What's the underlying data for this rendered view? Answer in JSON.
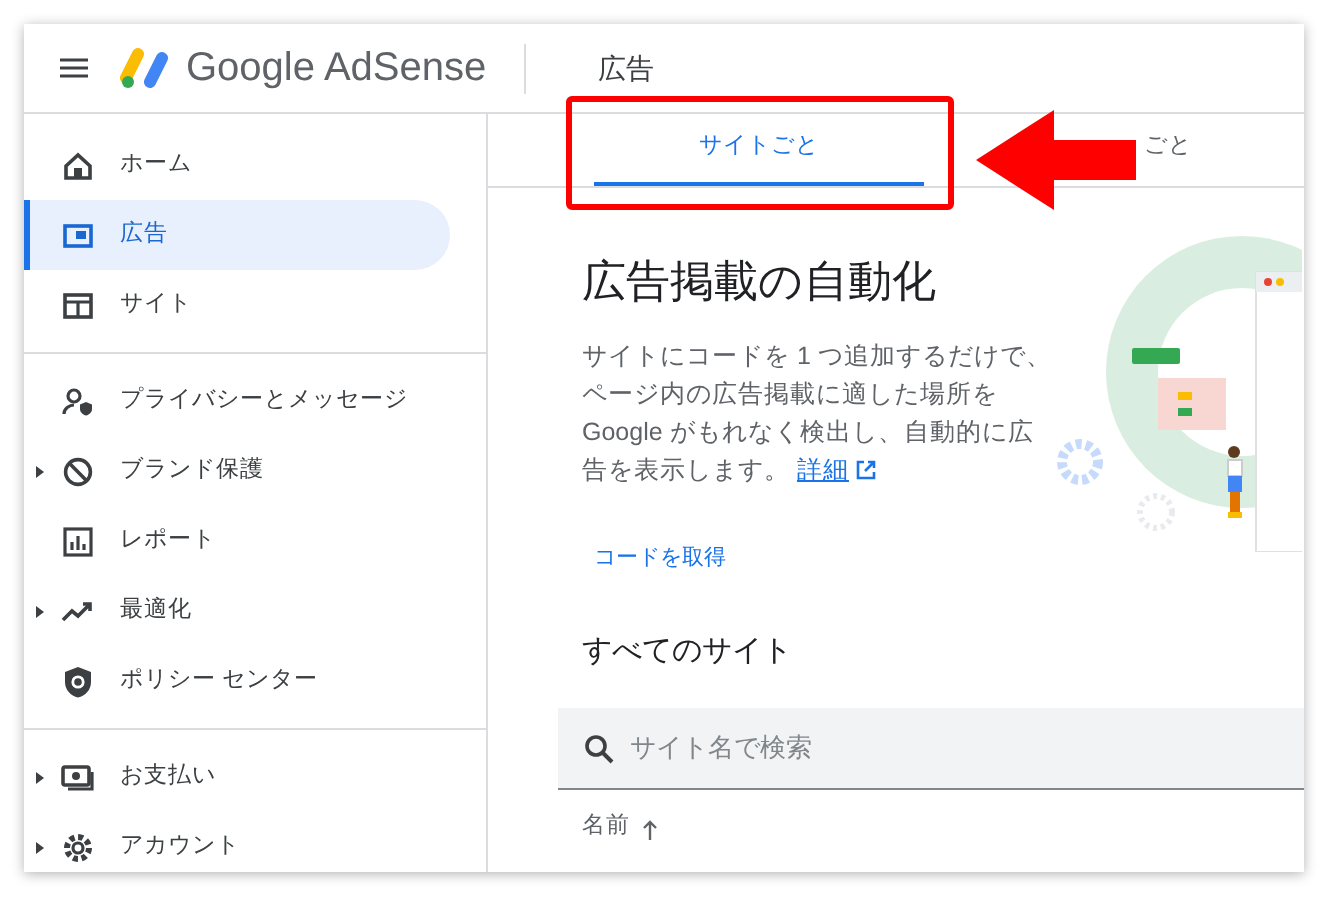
{
  "header": {
    "app_name": "Google AdSense",
    "page_title": "広告"
  },
  "sidebar": {
    "sections": [
      [
        {
          "label": "ホーム",
          "expandable": false,
          "selected": false
        },
        {
          "label": "広告",
          "expandable": false,
          "selected": true
        },
        {
          "label": "サイト",
          "expandable": false,
          "selected": false
        }
      ],
      [
        {
          "label": "プライバシーとメッセージ",
          "expandable": false,
          "selected": false
        },
        {
          "label": "ブランド保護",
          "expandable": true,
          "selected": false
        },
        {
          "label": "レポート",
          "expandable": false,
          "selected": false
        },
        {
          "label": "最適化",
          "expandable": true,
          "selected": false
        },
        {
          "label": "ポリシー センター",
          "expandable": false,
          "selected": false
        }
      ],
      [
        {
          "label": "お支払い",
          "expandable": true,
          "selected": false
        },
        {
          "label": "アカウント",
          "expandable": true,
          "selected": false
        }
      ]
    ]
  },
  "tabs": [
    {
      "label": "サイトごと",
      "selected": true
    },
    {
      "label": "ごと",
      "selected": false
    }
  ],
  "intro": {
    "title": "広告掲載の自動化",
    "text": "サイトにコードを 1 つ追加するだけで、ページ内の広告掲載に適した場所を Google がもれなく検出し、自動的に広告を表示します。",
    "link": "詳細",
    "action": "コードを取得"
  },
  "sites": {
    "heading": "すべてのサイト",
    "search": {
      "placeholder": "サイト名で検索"
    },
    "columns": [
      {
        "label": "名前",
        "sorted": true
      }
    ]
  }
}
